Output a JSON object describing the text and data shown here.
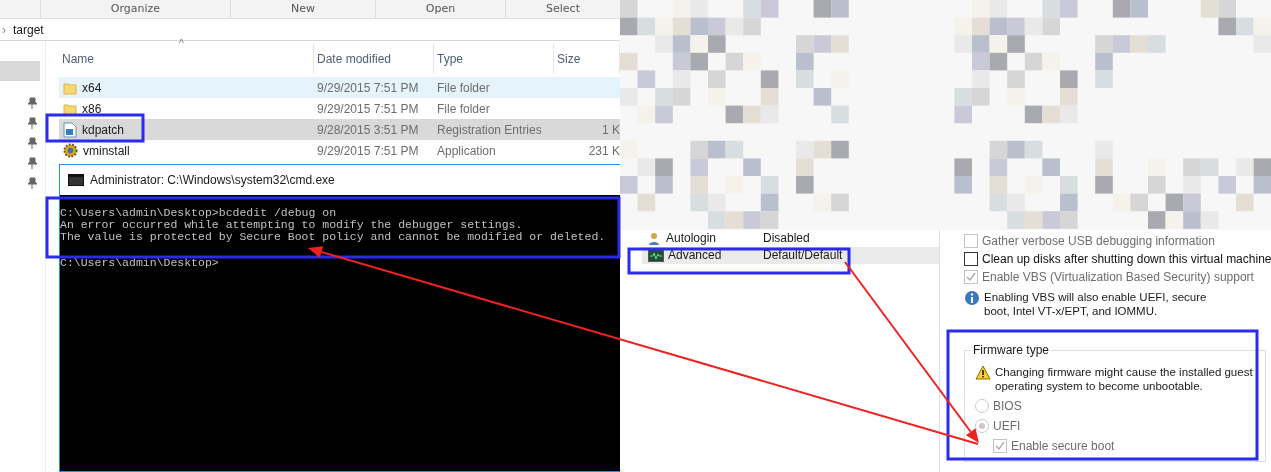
{
  "explorer": {
    "toolbar": [
      "Organize",
      "New",
      "Open",
      "Select"
    ],
    "path": {
      "chevron": "›",
      "folder": "target"
    },
    "sort_caret": "^",
    "columns": [
      "Name",
      "Date modified",
      "Type",
      "Size"
    ],
    "files": [
      {
        "kind": "folder",
        "name": "x64",
        "date": "9/29/2015 7:51 PM",
        "type": "File folder",
        "hovered": true,
        "selected": false
      },
      {
        "kind": "folder",
        "name": "x86",
        "date": "9/29/2015 7:51 PM",
        "type": "File folder",
        "hovered": false,
        "selected": false
      },
      {
        "kind": "registry",
        "name": "kdpatch",
        "date": "9/28/2015 3:51 PM",
        "type": "Registration Entries",
        "size": "1 K",
        "hovered": false,
        "selected": true
      },
      {
        "kind": "application",
        "name": "vminstall",
        "date": "9/29/2015 7:51 PM",
        "type": "Application",
        "size": "231 K",
        "hovered": false,
        "selected": false
      }
    ]
  },
  "console": {
    "title": "Administrator: C:\\Windows\\system32\\cmd.exe",
    "output": [
      "C:\\Users\\admin\\Desktop>bcdedit /debug on",
      "An error occurred while attempting to modify the debugger settings.",
      "The value is protected by Secure Boot policy and cannot be modified or deleted."
    ],
    "prompt": "C:\\Users\\admin\\Desktop>"
  },
  "vm_settings": {
    "items": [
      {
        "kind": "user",
        "name": "Autologin",
        "value": "Disabled",
        "selected": false
      },
      {
        "kind": "monitor",
        "name": "Advanced",
        "value": "Default/Default",
        "selected": true
      }
    ],
    "options": [
      {
        "label": "Gather verbose USB debugging information",
        "checked": false,
        "disabled": true
      },
      {
        "label": "Clean up disks after shutting down this virtual machine",
        "checked": false,
        "disabled": false
      },
      {
        "label": "Enable VBS (Virtualization Based Security) support",
        "checked": true,
        "disabled": true
      }
    ],
    "info": "Enabling VBS will also enable UEFI, secure boot, Intel VT-x/EPT, and IOMMU.",
    "firmware": {
      "title": "Firmware type",
      "warning": "Changing firmware might cause the installed guest operating system to become unbootable.",
      "types": [
        {
          "label": "BIOS",
          "selected": false,
          "disabled": true
        },
        {
          "label": "UEFI",
          "selected": true,
          "disabled": true
        }
      ],
      "secure_boot": {
        "label": "Enable secure boot",
        "checked": true,
        "disabled": true
      }
    }
  }
}
